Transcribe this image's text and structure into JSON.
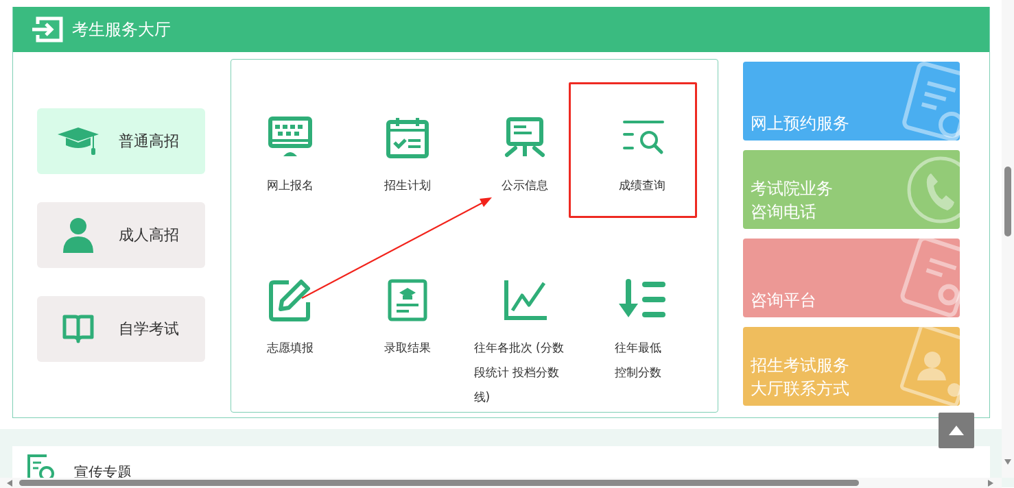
{
  "header": {
    "title": "考生服务大厅"
  },
  "categories": [
    {
      "label": "普通高招",
      "selected": true
    },
    {
      "label": "成人高招",
      "selected": false
    },
    {
      "label": "自学考试",
      "selected": false
    }
  ],
  "services": [
    {
      "label": "网上报名",
      "highlighted": false
    },
    {
      "label": "招生计划",
      "highlighted": false
    },
    {
      "label": "公示信息",
      "highlighted": false
    },
    {
      "label": "成绩查询",
      "highlighted": true
    },
    {
      "label": "志愿填报",
      "highlighted": false
    },
    {
      "label": "录取结果",
      "highlighted": false
    },
    {
      "label": "往年各批次 (分数段统计 投档分数线)",
      "highlighted": false
    },
    {
      "label": "往年最低控制分数",
      "highlighted": false
    }
  ],
  "quick_links": [
    {
      "lines": [
        "网上预约服务"
      ],
      "color": "#4aaef0"
    },
    {
      "lines": [
        "考试院业务",
        "咨询电话"
      ],
      "color": "#93cb77"
    },
    {
      "lines": [
        "咨询平台"
      ],
      "color": "#ec9895"
    },
    {
      "lines": [
        "招生考试服务",
        "大厅联系方式"
      ],
      "color": "#efbd5d"
    }
  ],
  "next_section": {
    "title": "宣传专题"
  }
}
